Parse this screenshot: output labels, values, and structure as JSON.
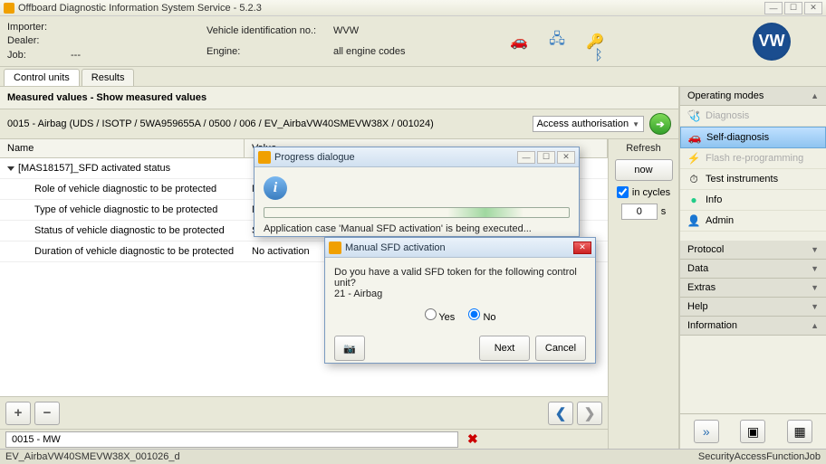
{
  "window": {
    "title": "Offboard Diagnostic Information System Service - 5.2.3"
  },
  "header": {
    "importer_label": "Importer:",
    "importer_value": "",
    "dealer_label": "Dealer:",
    "dealer_value": "",
    "job_label": "Job:",
    "job_value": "---",
    "vin_label": "Vehicle identification no.:",
    "vin_value": "WVW",
    "engine_label": "Engine:",
    "engine_value": "all engine codes"
  },
  "tabs": {
    "control_units": "Control units",
    "results": "Results"
  },
  "section_title": "Measured values - Show measured values",
  "identifier": "0015 - Airbag  (UDS / ISOTP / 5WA959655A / 0500 / 006 / EV_AirbaVW40SMEVW38X / 001024)",
  "access_combo": "Access authorisation",
  "table": {
    "name_header": "Name",
    "value_header": "Value",
    "group": "[MAS18157]_SFD activated status",
    "rows": [
      {
        "name": "Role of vehicle diagnostic to be protected",
        "value": "No"
      },
      {
        "name": "Type of vehicle diagnostic to be protected",
        "value": "No"
      },
      {
        "name": "Status of vehicle diagnostic to be protected",
        "value": "SF"
      },
      {
        "name": "Duration of vehicle diagnostic to be protected",
        "value": "No activation"
      }
    ]
  },
  "refresh": {
    "label": "Refresh",
    "now": "now",
    "cycles": "in cycles",
    "value": "0",
    "unit": "s"
  },
  "status_combo": "0015 - MW",
  "footer": {
    "left": "EV_AirbaVW40SMEVW38X_001026_d",
    "right": "SecurityAccessFunctionJob"
  },
  "right": {
    "modes_head": "Operating modes",
    "diagnosis": "Diagnosis",
    "self_diagnosis": "Self-diagnosis",
    "flash": "Flash re-programming",
    "test_instruments": "Test instruments",
    "info": "Info",
    "admin": "Admin",
    "protocol": "Protocol",
    "data": "Data",
    "extras": "Extras",
    "help": "Help",
    "information": "Information"
  },
  "progress": {
    "title": "Progress dialogue",
    "text": "Application case 'Manual SFD activation' is being executed..."
  },
  "sfd": {
    "title": "Manual SFD activation",
    "question": "Do you have a valid SFD token for the following control unit?",
    "unit": "21 - Airbag",
    "yes": "Yes",
    "no": "No",
    "next": "Next",
    "cancel": "Cancel"
  }
}
